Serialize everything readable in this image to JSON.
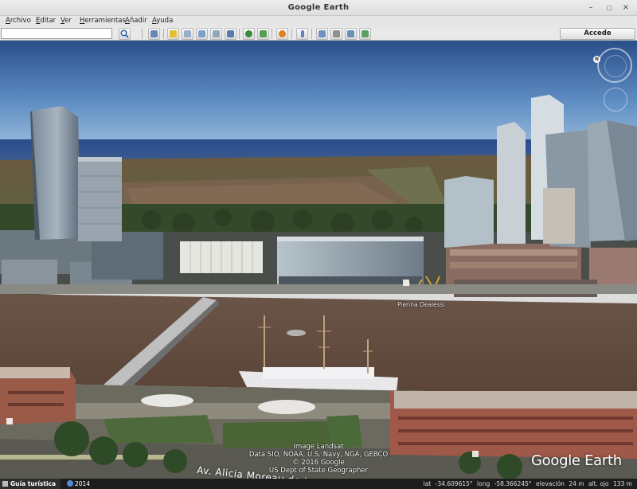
{
  "window": {
    "title": "Google Earth",
    "min": "–",
    "max": "□",
    "close": "×"
  },
  "menu": [
    {
      "label": "Archivo"
    },
    {
      "label": "Editar"
    },
    {
      "label": "Ver"
    },
    {
      "label": "Herramientas"
    },
    {
      "label": "Añadir"
    },
    {
      "label": "Ayuda"
    }
  ],
  "search": {
    "value": "",
    "placeholder": ""
  },
  "toolbar": {
    "signin_label": "Accede"
  },
  "view": {
    "place_label": "Pierina Dealessi",
    "street_label": "Av. Alicia Moreau de Justo",
    "attribution": [
      "Image Landsat",
      "Data SIO, NOAA, U.S. Navy, NGA, GEBCO",
      "© 2016 Google",
      "US Dept of State Geographer"
    ],
    "compass_north": "N",
    "logo": "Google Earth"
  },
  "status": {
    "tour_label": "Guía turística",
    "historical_year": "2014",
    "lat_label": "lat",
    "lat_value": "-34.609615°",
    "lon_label": "long",
    "lon_value": "-58.366245°",
    "elev_label": "elevación",
    "elev_value": "24 m",
    "eye_label": "alt. ojo",
    "eye_value": "133 m"
  }
}
